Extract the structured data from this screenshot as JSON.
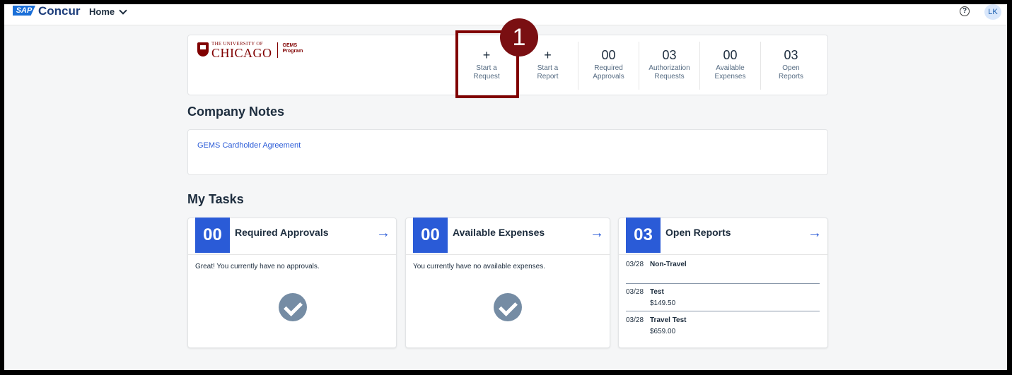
{
  "nav": {
    "logo": "SAP",
    "brand": "Concur",
    "home": "Home",
    "help": "?",
    "avatar": "LK"
  },
  "header": {
    "university_line1": "THE UNIVERSITY OF",
    "university_line2": "CHICAGO",
    "program_line1": "GEMS",
    "program_line2": "Program",
    "actions": [
      {
        "big": "+",
        "line1": "Start a",
        "line2": "Request"
      },
      {
        "big": "+",
        "line1": "Start a",
        "line2": "Report"
      },
      {
        "big": "00",
        "line1": "Required",
        "line2": "Approvals"
      },
      {
        "big": "03",
        "line1": "Authorization",
        "line2": "Requests"
      },
      {
        "big": "00",
        "line1": "Available",
        "line2": "Expenses"
      },
      {
        "big": "03",
        "line1": "Open",
        "line2": "Reports"
      }
    ],
    "step_badge": "1"
  },
  "company_notes": {
    "title": "Company Notes",
    "link": "GEMS Cardholder Agreement"
  },
  "my_tasks": {
    "title": "My Tasks",
    "cards": [
      {
        "count": "00",
        "title": "Required Approvals",
        "message": "Great! You currently have no approvals.",
        "arrow": "→"
      },
      {
        "count": "00",
        "title": "Available Expenses",
        "message": "You currently have no available expenses.",
        "arrow": "→"
      },
      {
        "count": "03",
        "title": "Open Reports",
        "arrow": "→"
      }
    ],
    "reports": [
      {
        "date": "03/28",
        "name": "Non-Travel",
        "amount": ""
      },
      {
        "date": "03/28",
        "name": "Test",
        "amount": "$149.50"
      },
      {
        "date": "03/28",
        "name": "Travel Test",
        "amount": "$659.00"
      }
    ]
  },
  "colors": {
    "accent": "#2a5bd7",
    "uchicago_maroon": "#800000",
    "highlight": "#7a0f12"
  }
}
